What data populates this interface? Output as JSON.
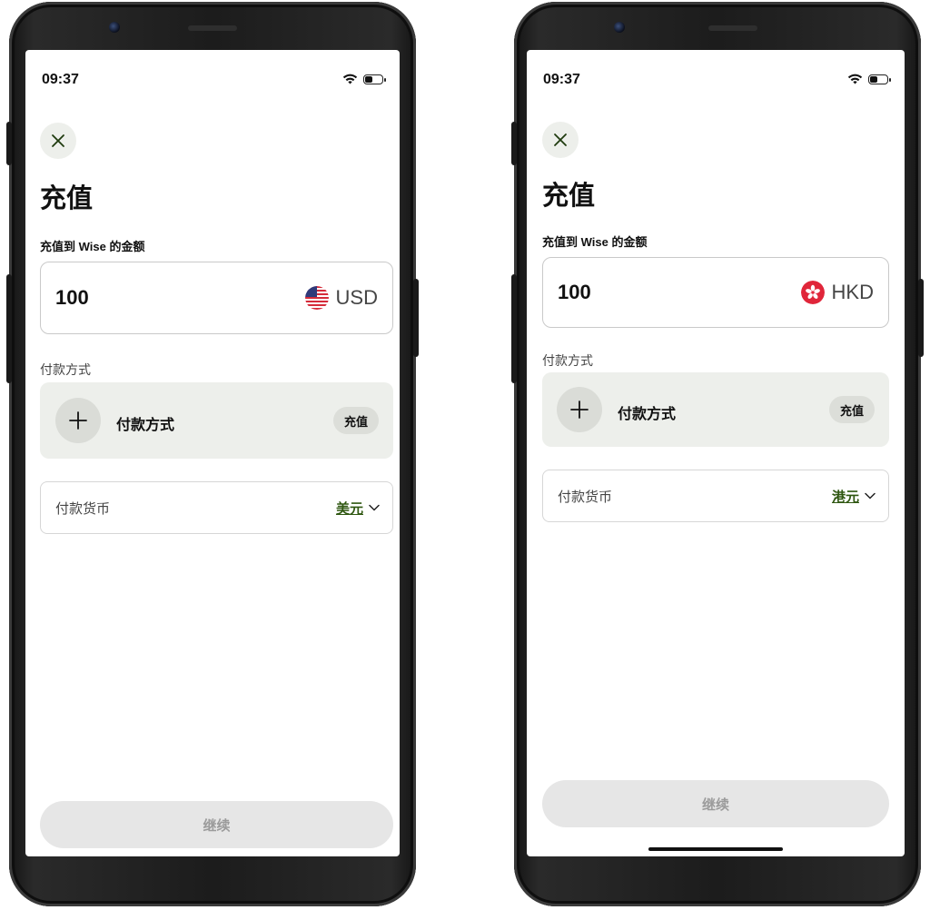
{
  "phones": [
    {
      "status": {
        "time": "09:37"
      },
      "close_icon": "close-icon",
      "title": "充值",
      "amount_label": "充值到 Wise 的金额",
      "amount": {
        "value": "100",
        "currency_code": "USD",
        "flag": "us-flag-icon"
      },
      "payment_method_label": "付款方式",
      "payment_method": {
        "text": "付款方式",
        "action": "充值"
      },
      "pay_currency": {
        "label": "付款货币",
        "value": "美元"
      },
      "continue_label": "继续"
    },
    {
      "status": {
        "time": "09:37"
      },
      "close_icon": "close-icon",
      "title": "充值",
      "amount_label": "充值到 Wise 的金额",
      "amount": {
        "value": "100",
        "currency_code": "HKD",
        "flag": "hk-flag-icon"
      },
      "payment_method_label": "付款方式",
      "payment_method": {
        "text": "付款方式",
        "action": "充值"
      },
      "pay_currency": {
        "label": "付款货币",
        "value": "港元"
      },
      "continue_label": "继续"
    }
  ],
  "colors": {
    "accent_link": "#2f5711",
    "card_bg": "#edefeb",
    "disabled_button_bg": "#e6e6e6",
    "disabled_button_text": "#9b9b9b"
  }
}
